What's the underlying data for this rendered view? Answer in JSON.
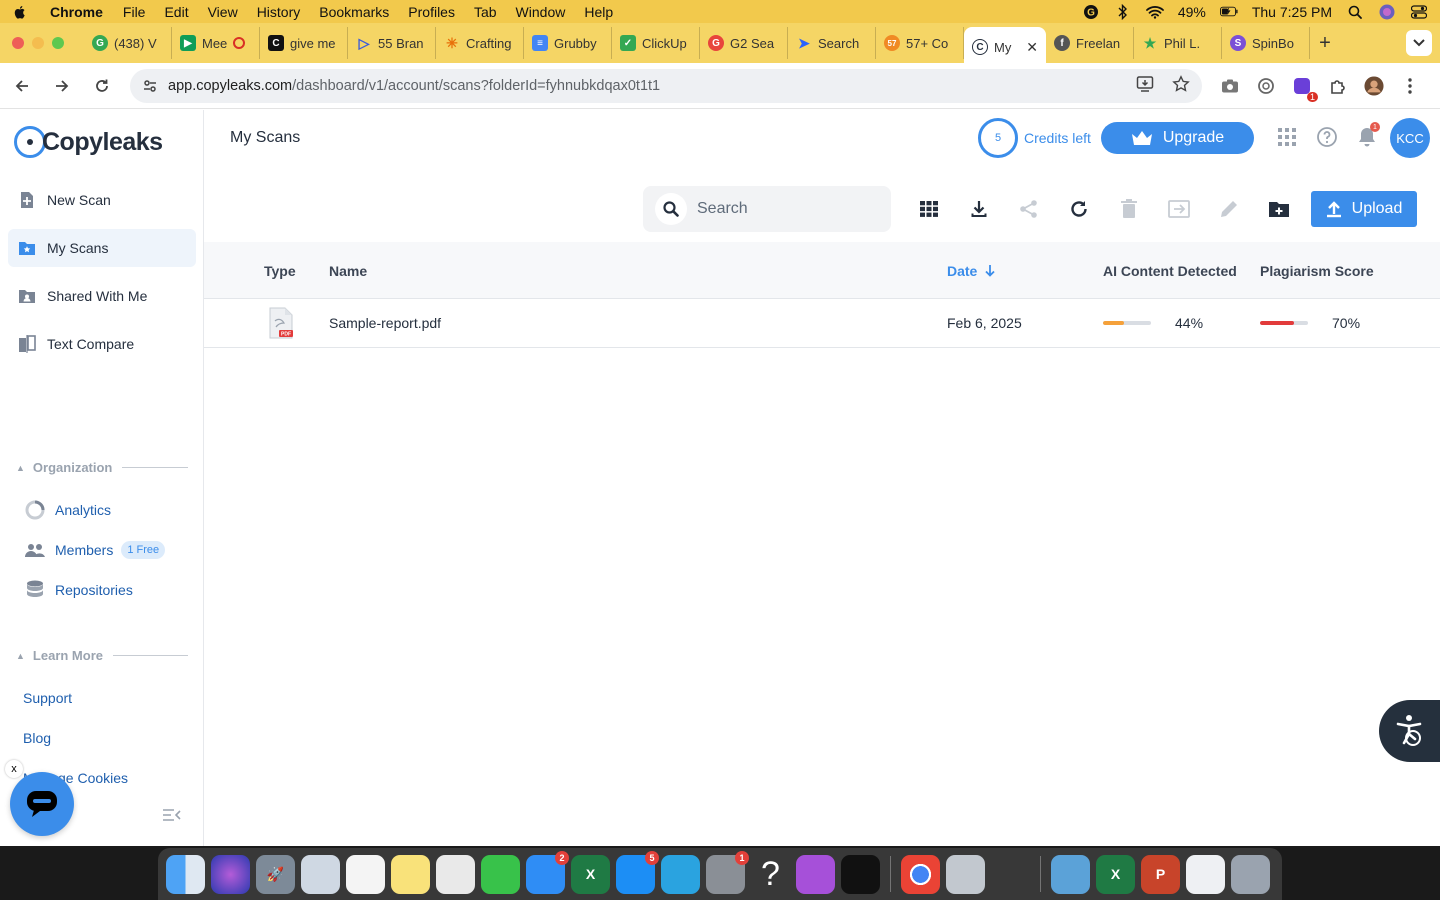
{
  "menubar": {
    "app_name": "Chrome",
    "items": [
      "File",
      "Edit",
      "View",
      "History",
      "Bookmarks",
      "Profiles",
      "Tab",
      "Window",
      "Help"
    ],
    "battery": "49%",
    "clock": "Thu 7:25 PM"
  },
  "tabs": [
    {
      "label": "(438) V",
      "color": "#34a853",
      "icon": "g"
    },
    {
      "label": "Mee",
      "color": "#0f9d58",
      "icon": "meet"
    },
    {
      "label": "give me",
      "color": "#111111",
      "icon": "c"
    },
    {
      "label": "55 Bran",
      "color": "#3b5bdb",
      "icon": "play"
    },
    {
      "label": "Crafting",
      "color": "#e8710a",
      "icon": "star"
    },
    {
      "label": "Grubby",
      "color": "#4285f4",
      "icon": "doc"
    },
    {
      "label": "ClickUp",
      "color": "#34a853",
      "icon": "check"
    },
    {
      "label": "G2 Sea",
      "color": "#e8453c",
      "icon": "g2"
    },
    {
      "label": "Search",
      "color": "#2962ff",
      "icon": "arrow"
    },
    {
      "label": "57+ Co",
      "color": "#f08a24",
      "icon": "57"
    },
    {
      "label": "My",
      "color": "#252f3e",
      "icon": "copyleaks",
      "active": true
    },
    {
      "label": "Freelan",
      "color": "#555555",
      "icon": "f"
    },
    {
      "label": "Phil L.",
      "color": "#34a853",
      "icon": "star"
    },
    {
      "label": "SpinBo",
      "color": "#7b4fd6",
      "icon": "spin"
    }
  ],
  "address": {
    "host": "app.copyleaks.com",
    "path": "/dashboard/v1/account/scans?folderId=fyhnubkdqax0t1t1",
    "ext_badge": "1"
  },
  "brand": {
    "name": "Copyleaks",
    "accent": "#3b8dea",
    "danger": "#e23b3b",
    "warning": "#f5a13a"
  },
  "sidebar": {
    "items": [
      {
        "label": "New Scan",
        "icon": "new-scan-icon"
      },
      {
        "label": "My Scans",
        "icon": "my-scans-icon",
        "selected": true
      },
      {
        "label": "Shared With Me",
        "icon": "shared-folder-icon"
      },
      {
        "label": "Text Compare",
        "icon": "text-compare-icon"
      }
    ],
    "organization_header": "Organization",
    "organization": [
      {
        "label": "Analytics",
        "icon": "analytics-icon"
      },
      {
        "label": "Members",
        "icon": "members-icon",
        "pill": "1 Free"
      },
      {
        "label": "Repositories",
        "icon": "database-icon"
      }
    ],
    "learn_header": "Learn More",
    "learn": [
      "Support",
      "Blog",
      "Manage Cookies"
    ]
  },
  "header": {
    "title": "My Scans",
    "credits_count": "5",
    "credits_label": "Credits left",
    "upgrade_label": "Upgrade",
    "notification_count": "1",
    "avatar_initials": "KCC"
  },
  "toolbar": {
    "search_placeholder": "Search",
    "upload_label": "Upload"
  },
  "table": {
    "columns": {
      "type": "Type",
      "name": "Name",
      "date": "Date",
      "ai": "AI Content Detected",
      "plagiarism": "Plagiarism Score"
    },
    "rows": [
      {
        "name": "Sample-report.pdf",
        "file_type": "PDF",
        "date": "Feb 6, 2025",
        "ai": "44%",
        "ai_value": 0.44,
        "plagiarism": "70%",
        "plagiarism_value": 0.7
      }
    ]
  },
  "dock": {
    "messages_badge": "2",
    "appstore_badge": "5",
    "settings_badge": "1"
  }
}
